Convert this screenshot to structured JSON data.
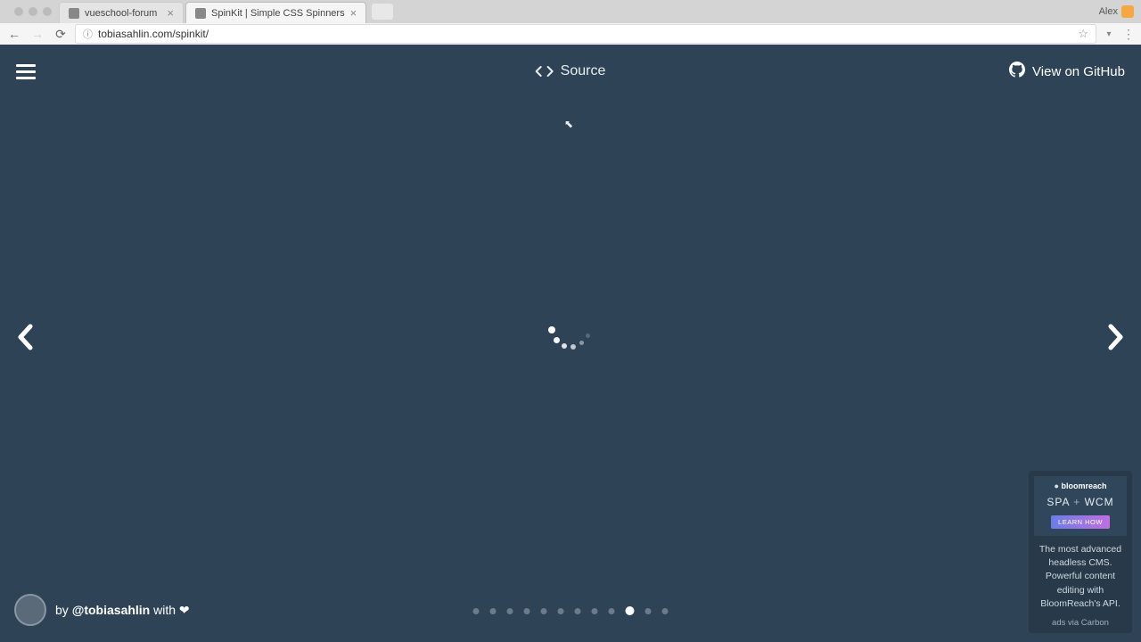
{
  "browser": {
    "tabs": [
      {
        "title": "vueschool-forum",
        "active": false
      },
      {
        "title": "SpinKit | Simple CSS Spinners",
        "active": true
      }
    ],
    "url": "tobiasahlin.com/spinkit/",
    "user": "Alex"
  },
  "header": {
    "source_label": "Source",
    "github_label": "View on GitHub"
  },
  "pagination": {
    "total": 12,
    "active_index": 9
  },
  "attribution": {
    "prefix": "by ",
    "handle": "@tobiasahlin",
    "suffix": " with ❤"
  },
  "ad": {
    "logo_text": "bloomreach",
    "title_left": "SPA",
    "title_plus": "+",
    "title_right": "WCM",
    "cta": "LEARN HOW",
    "copy": "The most advanced headless CMS. Powerful content editing with BloomReach's API.",
    "via": "ads via Carbon"
  }
}
